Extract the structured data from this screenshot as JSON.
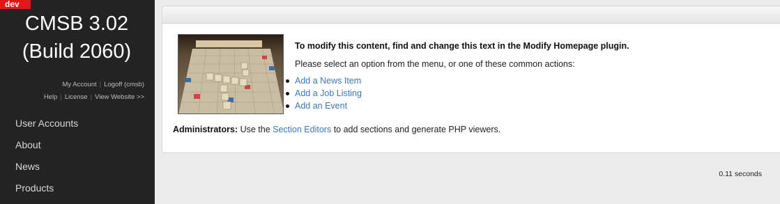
{
  "sidebar": {
    "badge": "dev",
    "title_line1": "CMSB 3.02",
    "title_line2": "(Build 2060)",
    "links_row1": [
      "My Account",
      "Logoff (cmsb)"
    ],
    "links_row2": [
      "Help",
      "License",
      "View Website >>"
    ],
    "menu": [
      "User Accounts",
      "About",
      "News",
      "Products"
    ]
  },
  "main": {
    "headline": "To modify this content, find and change this text in the Modify Homepage plugin.",
    "intro": "Please select an option from the menu, or one of these common actions:",
    "actions": [
      "Add a News Item",
      "Add a Job Listing",
      "Add an Event"
    ],
    "admin_label": "Administrators:",
    "admin_text_before": "Use the",
    "admin_link": "Section Editors",
    "admin_text_after": "to add sections and generate PHP viewers."
  },
  "footer": {
    "timing": "0.11 seconds"
  },
  "colors": {
    "sidebar_bg": "#232323",
    "badge_bg": "#e01818",
    "link": "#3a78b8"
  }
}
